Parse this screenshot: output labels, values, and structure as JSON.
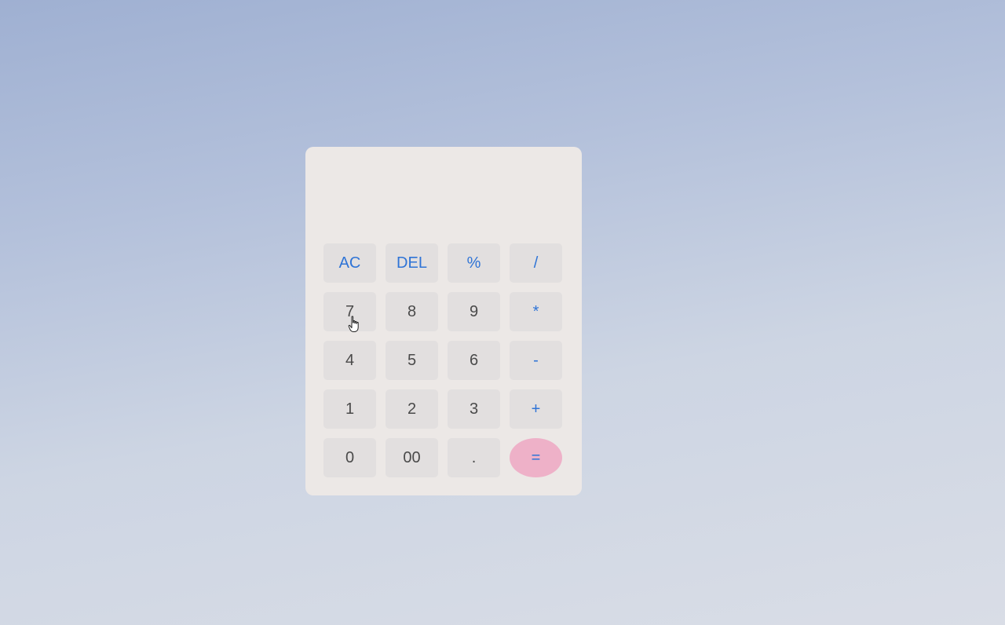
{
  "calculator": {
    "display_value": "",
    "keys": [
      {
        "label": "AC",
        "type": "op"
      },
      {
        "label": "DEL",
        "type": "op"
      },
      {
        "label": "%",
        "type": "op"
      },
      {
        "label": "/",
        "type": "op"
      },
      {
        "label": "7",
        "type": "num"
      },
      {
        "label": "8",
        "type": "num"
      },
      {
        "label": "9",
        "type": "num"
      },
      {
        "label": "*",
        "type": "op"
      },
      {
        "label": "4",
        "type": "num"
      },
      {
        "label": "5",
        "type": "num"
      },
      {
        "label": "6",
        "type": "num"
      },
      {
        "label": "-",
        "type": "op"
      },
      {
        "label": "1",
        "type": "num"
      },
      {
        "label": "2",
        "type": "num"
      },
      {
        "label": "3",
        "type": "num"
      },
      {
        "label": "+",
        "type": "op"
      },
      {
        "label": "0",
        "type": "num"
      },
      {
        "label": "00",
        "type": "num"
      },
      {
        "label": ".",
        "type": "num"
      },
      {
        "label": "=",
        "type": "equals"
      }
    ]
  },
  "colors": {
    "operator_text": "#2f74d6",
    "number_text": "#4a4a4a",
    "key_background": "#e2dfdf",
    "equals_background": "#eeb1c8",
    "calculator_background": "#ece8e6"
  },
  "cursor": {
    "icon": "hand-pointer-icon"
  }
}
